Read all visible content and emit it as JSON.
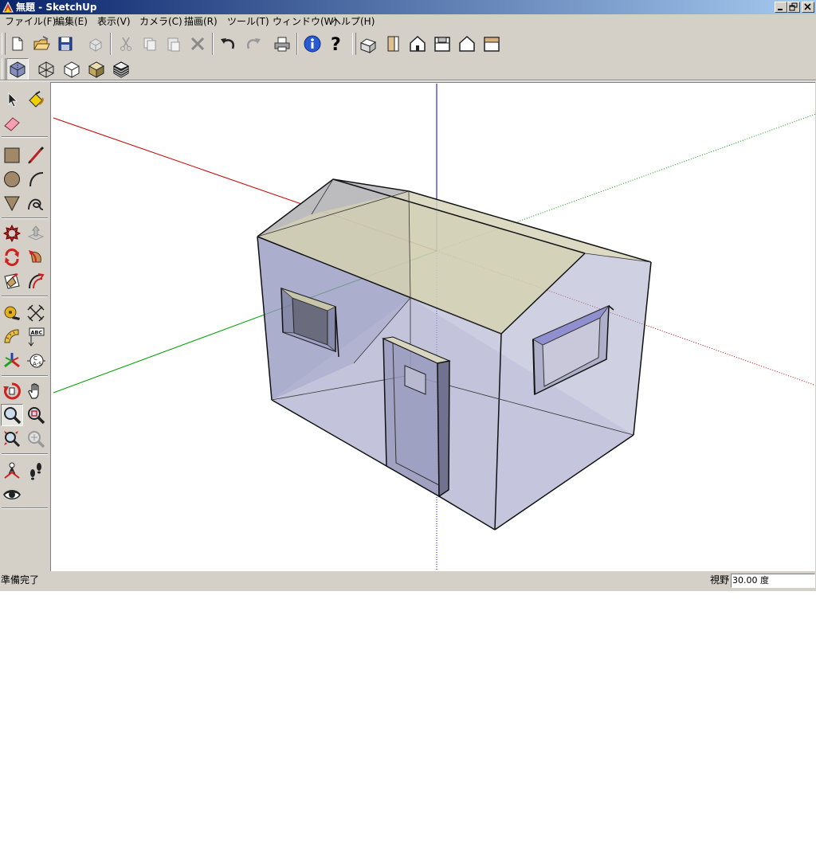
{
  "window": {
    "title": "無題 - SketchUp",
    "controls": [
      "minimize",
      "restore",
      "close"
    ]
  },
  "menubar": {
    "items": [
      "ファイル(F)",
      "編集(E)",
      "表示(V)",
      "カメラ(C)",
      "描画(R)",
      "ツール(T)",
      "ウィンドウ(W)",
      "ヘルプ(H)"
    ]
  },
  "toolbar_standard": {
    "buttons": [
      "new-icon",
      "open-icon",
      "save-icon",
      "make-component-icon",
      "cut-icon",
      "copy-icon",
      "paste-icon",
      "erase-icon",
      "undo-icon",
      "redo-icon",
      "print-icon",
      "model-info-icon",
      "help-icon"
    ]
  },
  "toolbar_views": {
    "buttons": [
      "iso-view-icon",
      "top-view-icon",
      "front-view-icon",
      "right-view-icon",
      "back-view-icon",
      "left-view-icon"
    ]
  },
  "toolbar_styles": {
    "buttons": [
      "xray-icon",
      "wireframe-icon",
      "hidden-line-icon",
      "shaded-icon",
      "shaded-textures-icon"
    ],
    "active": "xray-icon"
  },
  "palette": {
    "groups": [
      [
        "select-icon",
        "paint-bucket-icon",
        "eraser-icon"
      ],
      [
        "rectangle-icon",
        "line-icon",
        "circle-icon",
        "arc-icon",
        "polygon-icon",
        "freehand-icon"
      ],
      [
        "move-icon",
        "push-pull-icon",
        "rotate-icon",
        "follow-me-icon",
        "scale-icon",
        "offset-icon"
      ],
      [
        "tape-measure-icon",
        "dimension-icon",
        "protractor-icon",
        "text-icon",
        "axes-icon",
        "3d-text-icon"
      ],
      [
        "orbit-icon",
        "pan-icon",
        "zoom-icon",
        "zoom-window-icon",
        "zoom-extents-icon",
        "previous-view-icon"
      ],
      [
        "position-camera-icon",
        "walk-icon",
        "look-around-icon"
      ]
    ],
    "active": "zoom-icon"
  },
  "viewport": {
    "axis_colors": {
      "red": "#c80000",
      "green": "#00a000",
      "blue": "#0000c8"
    },
    "model": "house-xray"
  },
  "status": {
    "text": "準備完了",
    "fov_label": "視野",
    "fov_value": "30.00 度"
  }
}
